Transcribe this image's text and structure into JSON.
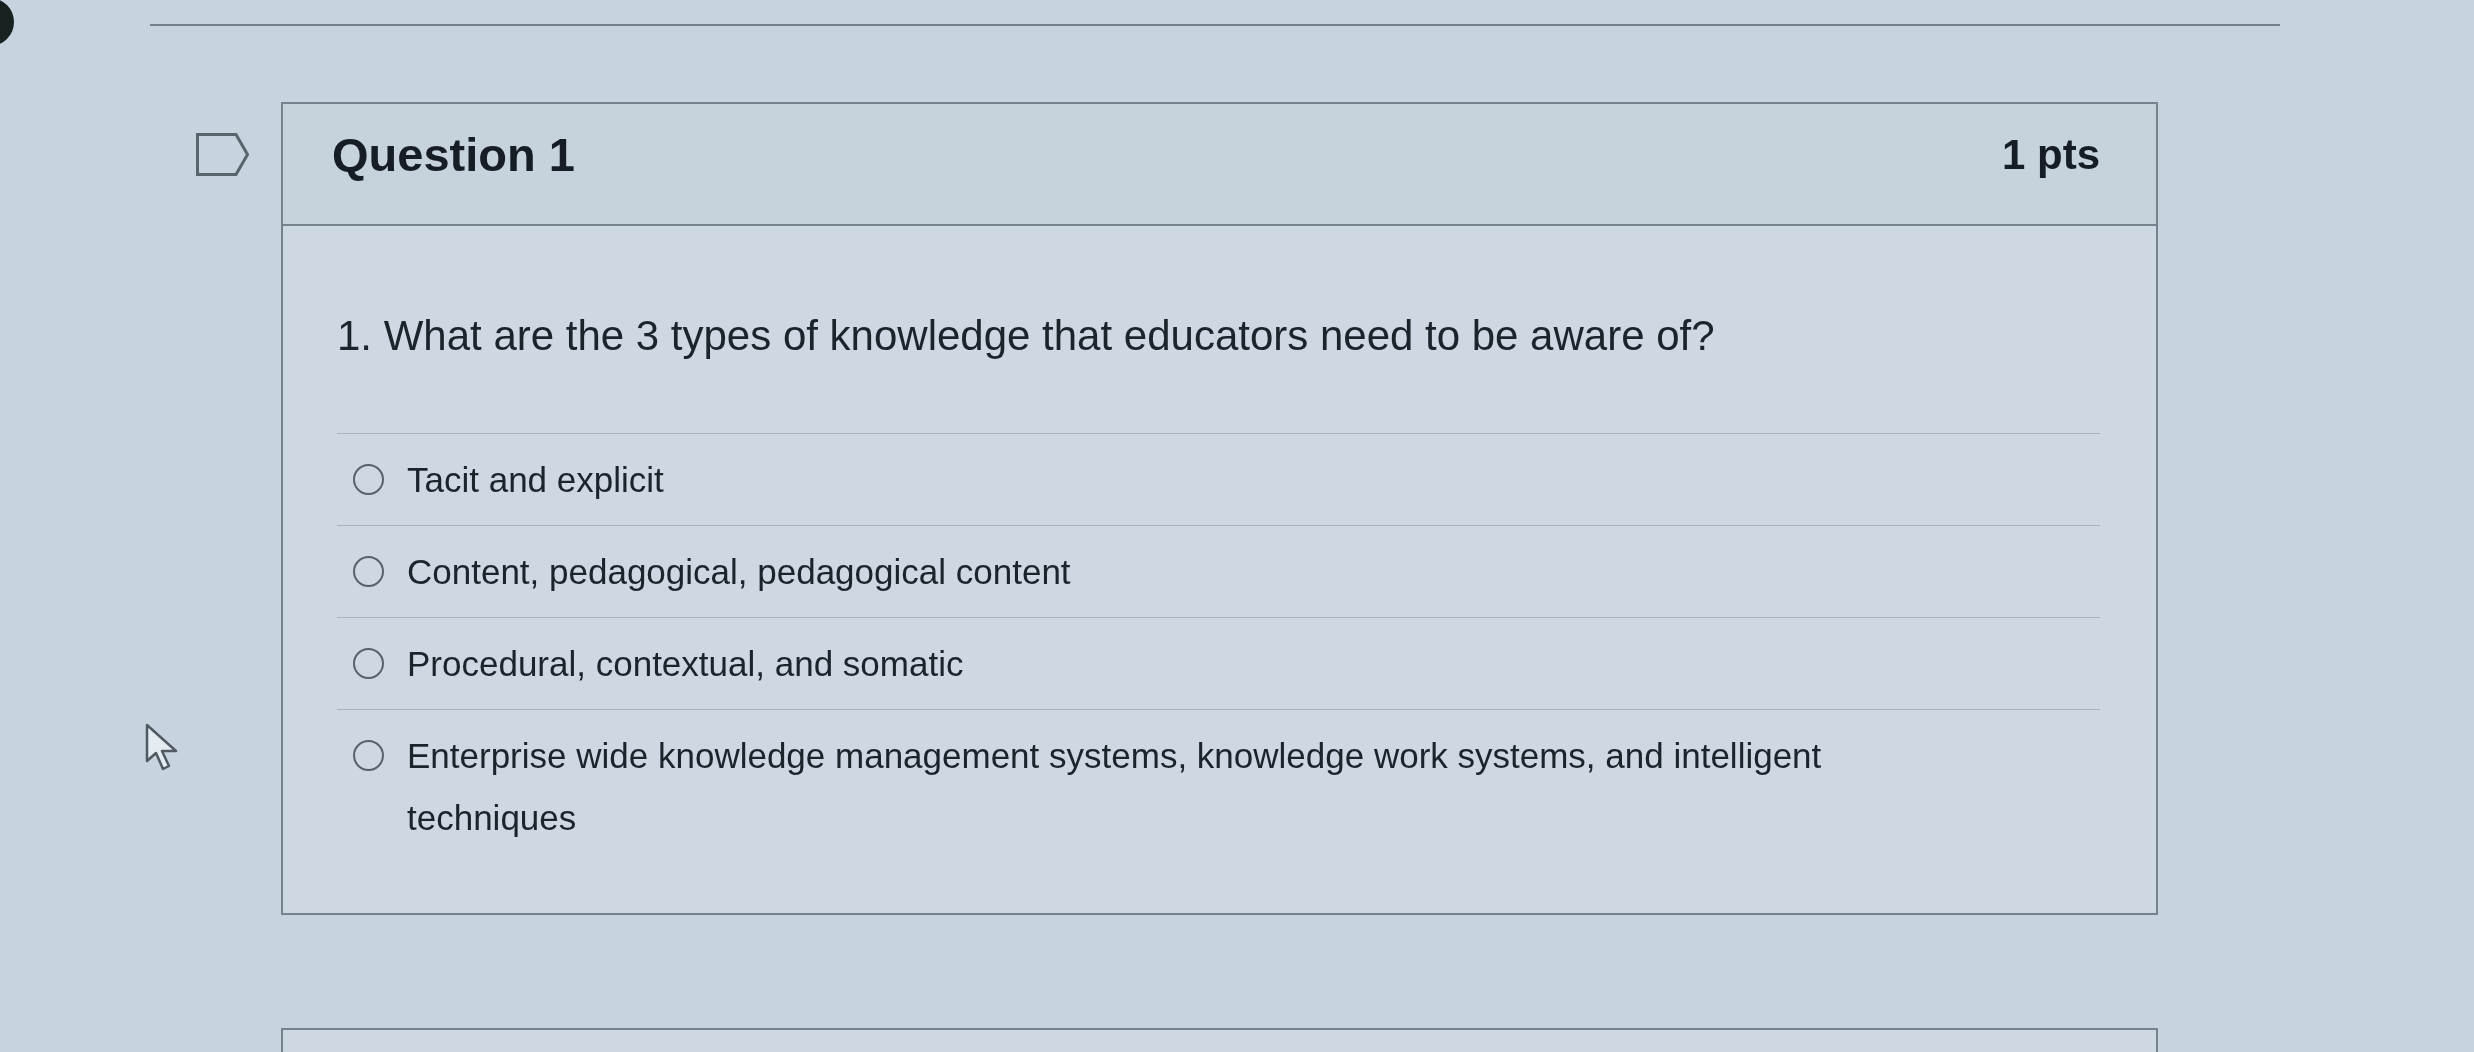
{
  "question": {
    "title": "Question 1",
    "points": "1 pts",
    "flagged": false,
    "prompt": "1. What are the 3 types of knowledge that educators need to be aware of?",
    "answers": [
      {
        "label": "Tacit and explicit",
        "selected": false
      },
      {
        "label": "Content, pedagogical, pedagogical content",
        "selected": false
      },
      {
        "label": "Procedural, contextual, and somatic",
        "selected": false
      },
      {
        "label": "Enterprise wide knowledge management systems, knowledge work systems, and intelligent techniques",
        "selected": false
      }
    ]
  }
}
